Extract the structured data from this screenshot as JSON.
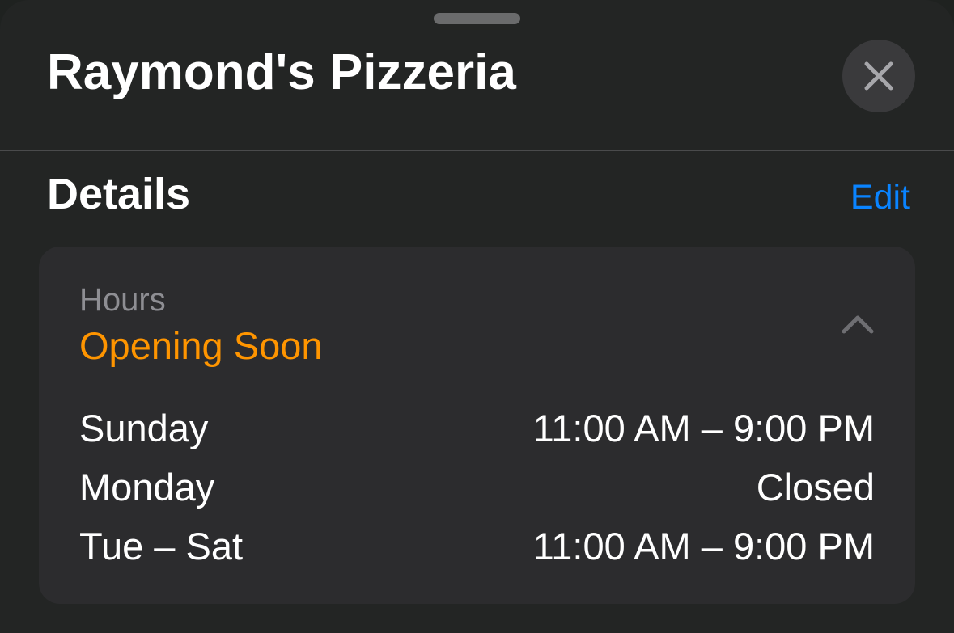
{
  "place": {
    "title": "Raymond's Pizzeria"
  },
  "details": {
    "title": "Details",
    "edit_label": "Edit"
  },
  "hours": {
    "label": "Hours",
    "status": "Opening Soon",
    "rows": [
      {
        "day": "Sunday",
        "time": "11:00 AM – 9:00 PM"
      },
      {
        "day": "Monday",
        "time": "Closed"
      },
      {
        "day": "Tue – Sat",
        "time": "11:00 AM – 9:00 PM"
      }
    ]
  },
  "icons": {
    "close": "close-icon",
    "collapse": "chevron-up-icon"
  },
  "colors": {
    "accent_link": "#0a84ff",
    "status_orange": "#ff9500",
    "card_background": "#2c2c2e",
    "sheet_background": "#232524"
  }
}
